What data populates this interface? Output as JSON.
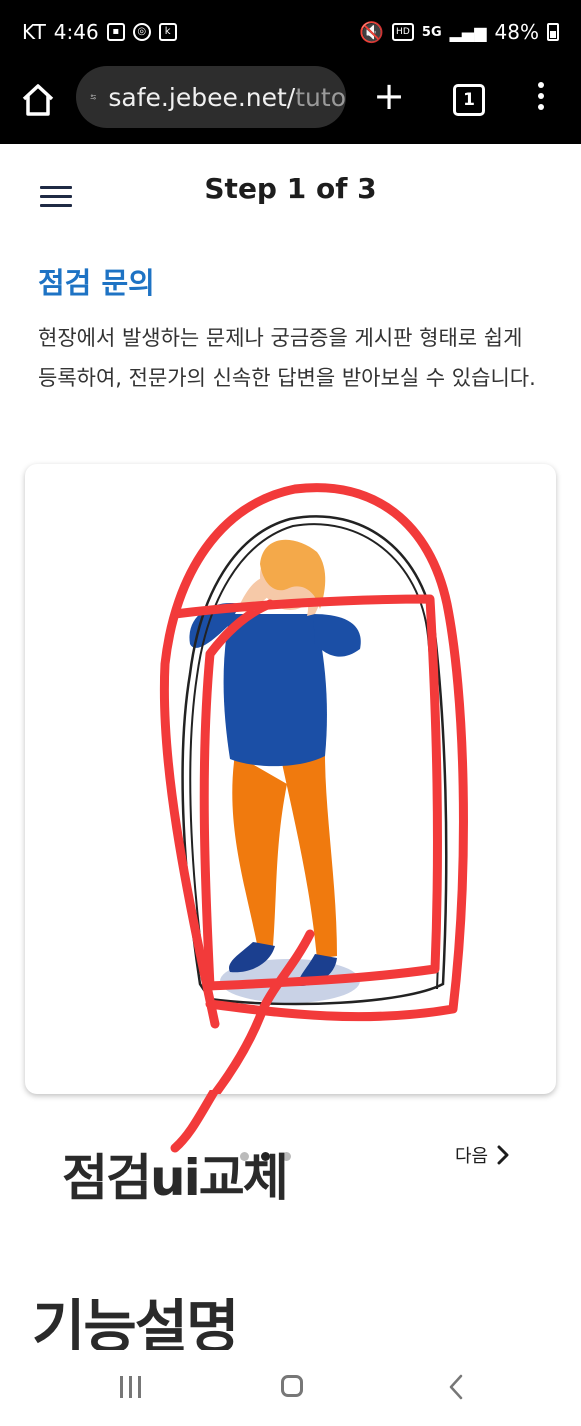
{
  "status_bar": {
    "carrier": "KT",
    "time": "4:46",
    "network": "5G",
    "battery": "48%",
    "icons": [
      "gallery-icon",
      "sync-icon",
      "kt-app-icon",
      "mute-icon",
      "hd-voice-icon",
      "5g-icon",
      "signal-icon",
      "battery-icon"
    ]
  },
  "browser": {
    "url_main": "safe.jebee.net/",
    "url_rest": "tuto",
    "tab_count": "1"
  },
  "page": {
    "step_title": "Step 1 of 3",
    "section_title": "점검 문의",
    "description": "현장에서 발생하는 문제나 궁금증을 게시판 형태로 쉽게 등록하여, 전문가의 신속한 답변을 받아보실 수 있습니다.",
    "next_label": "다음",
    "page_dot_count": 3,
    "active_dot": 1
  },
  "annotations": {
    "note_1": "점검ui교체",
    "note_2": "기능설명",
    "stroke_color": "#f23a3a"
  },
  "colors": {
    "accent": "#1e73c4",
    "shirt": "#1b4fa6",
    "pants": "#f07a0e",
    "hair": "#f4a94a"
  }
}
